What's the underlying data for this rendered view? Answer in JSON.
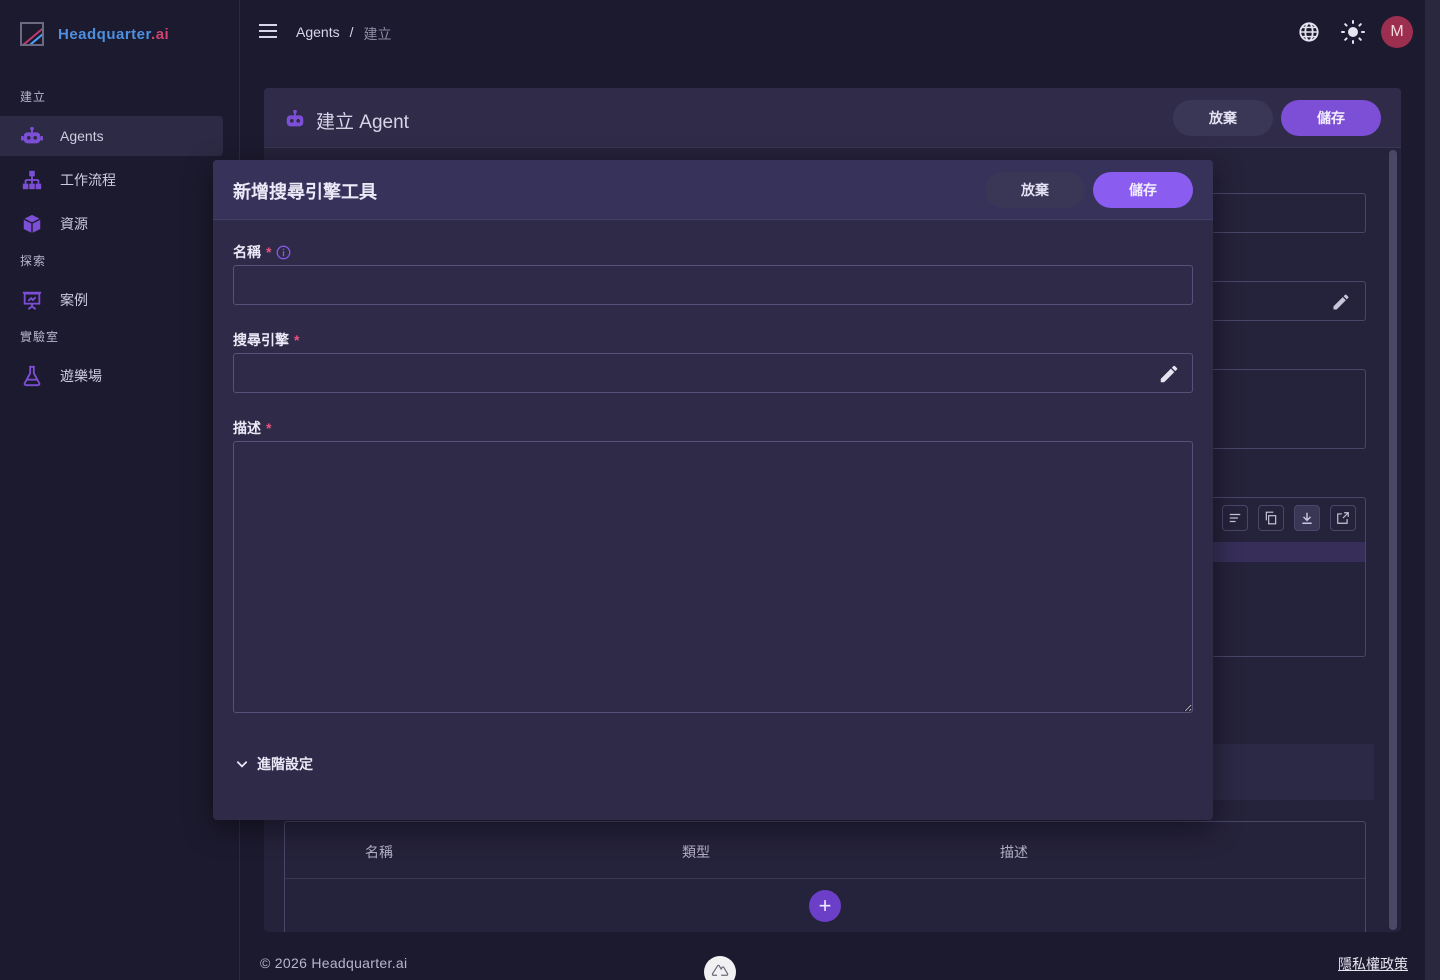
{
  "brand": {
    "name_main": "Headquarter",
    "name_suffix": ".ai"
  },
  "sidebar": {
    "sections": [
      {
        "label": "建立"
      },
      {
        "label": "探索"
      },
      {
        "label": "實驗室"
      }
    ],
    "items": [
      {
        "label": "Agents",
        "icon": "robot-icon",
        "active": true
      },
      {
        "label": "工作流程",
        "icon": "sitemap-icon"
      },
      {
        "label": "資源",
        "icon": "cube-icon"
      },
      {
        "label": "案例",
        "icon": "presentation-icon"
      },
      {
        "label": "遊樂場",
        "icon": "flask-icon"
      }
    ]
  },
  "topbar": {
    "breadcrumb": {
      "parent": "Agents",
      "separator": "/",
      "current": "建立"
    },
    "avatar_initial": "M"
  },
  "card": {
    "title": "建立 Agent",
    "discard_label": "放棄",
    "save_label": "儲存",
    "table": {
      "columns": [
        "名稱",
        "類型",
        "描述"
      ],
      "add_label": "+"
    }
  },
  "modal": {
    "title": "新增搜尋引擎工具",
    "discard_label": "放棄",
    "save_label": "儲存",
    "fields": {
      "name": {
        "label": "名稱",
        "required": "*",
        "value": ""
      },
      "engine": {
        "label": "搜尋引擎",
        "required": "*",
        "value": ""
      },
      "description": {
        "label": "描述",
        "required": "*",
        "value": ""
      }
    },
    "advanced_label": "進階設定"
  },
  "footer": {
    "copyright": "© 2026 Headquarter.ai",
    "privacy_link": "隱私權政策"
  },
  "colors": {
    "accent": "#7c4fd6",
    "required": "#e8557f",
    "background": "#1c1a2e"
  }
}
